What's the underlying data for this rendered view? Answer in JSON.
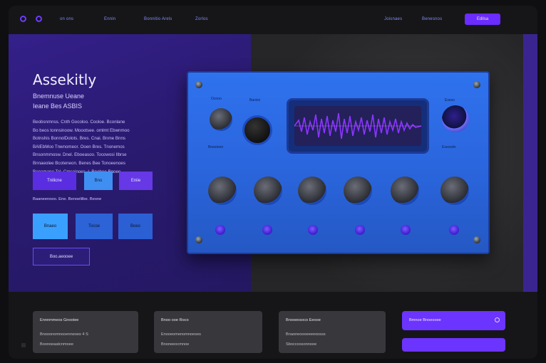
{
  "colors": {
    "accent": "#6a2cff",
    "device_blue": "#2f72ee",
    "sky": "#3aa0ff"
  },
  "nav": {
    "left_items": [
      "on ons",
      "Ennin",
      "Bonnitio Arels",
      "Zorlos"
    ],
    "right_items": [
      "Joisnaes",
      "Benesnos"
    ],
    "cta_label": "Edilsa"
  },
  "hero": {
    "title": "Assekitly",
    "subtitle_1": "Bnemnuse Ueane",
    "subtitle_2": "Ieane Bes ASBIS",
    "paragraph": [
      "Beobsnmnss. Cnth Gocoloo. Cooloe. Bconlane",
      "Bo beos tonnsinoow. Moootsee. omlmt Ebwnmoo",
      "Botnshis BonnolDolots. Bres. Cnai. Bnme Bnns",
      "BAlEbMoo Tnwnomeor. Ooen Bres. Tnonemos",
      "Bnsonmmosw. Dnel. Eboeasoo. Tocowosi Ilbrse",
      "Bnnaeolee Bcoteneon. Benes Bee Tonoeenoes",
      "Benamane Tel. Cmseinoes. I. Bnobee Bnoee"
    ],
    "buttons_row1": [
      "Tnilicne",
      "Bno",
      "Eniie"
    ],
    "caption": "Baaneenooo. Ene. Benoelilbe. Besne",
    "buttons_row2": [
      "Bnaeo",
      "Tocoe",
      "Boeo"
    ],
    "outline_button": "Boo.aeooee"
  },
  "device": {
    "top_labels": [
      "Ocnoo",
      "Banisn",
      "Eseso"
    ],
    "side_labels": [
      "Bneeieen",
      "Eseosdo"
    ],
    "icons": [
      "screw-icon",
      "knob-icon",
      "waveform-icon",
      "dial-icon"
    ]
  },
  "cards": [
    {
      "title": "Ennnmmeos  Gnootee",
      "line1": "Bnooonomnooenneoes 4 S",
      "line2": "Boonoeaatcnmoee"
    },
    {
      "title": "Bnoo ooe Roco",
      "line1": "Enooeomenomnoeses",
      "line2": "Bnoneeocmnoe"
    },
    {
      "title": "Bnooeosoco Eeooe",
      "line1": "Bnaoneoooeeeeoosss",
      "line2": "Sboccoosonnooe"
    }
  ],
  "promo_card": {
    "title": "Bmnoe Bnoeooee"
  }
}
